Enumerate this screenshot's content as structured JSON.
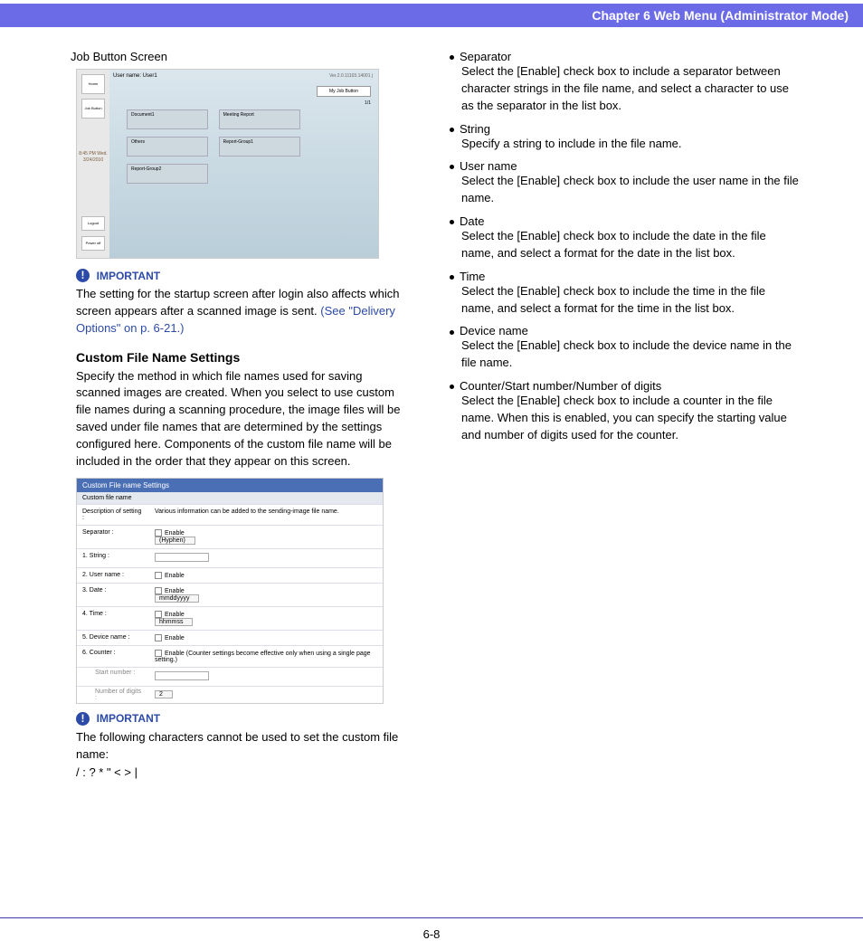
{
  "header": {
    "title": "Chapter 6   Web Menu (Administrator Mode)"
  },
  "left": {
    "caption1": "Job Button Screen",
    "ss1": {
      "user": "User name:  User1",
      "ver": "Ver.2.0.11103.14001 j",
      "btn": "My Job Button",
      "page": "1/1",
      "home": "Home",
      "jobbtn": "Job Button",
      "time": "8:45 PM Wed. 3/24/2010",
      "logout": "Logout",
      "power": "Power off",
      "tiles": [
        "Document1",
        "Meeting Report",
        "Others",
        "Report-Group1",
        "Report-Group2"
      ]
    },
    "imp1": {
      "label": "IMPORTANT",
      "text": "The setting for the startup screen after login also affects which screen appears after a scanned image is sent. ",
      "link": "(See \"Delivery Options\" on p. 6-21.)"
    },
    "h2": "Custom File Name Settings",
    "para1": "Specify the method in which file names used for saving scanned images are created. When you select to use custom file names during a scanning procedure, the image files will be saved under file names that are determined by the settings configured here. Components of the custom file name will be included in the order that they appear on this screen.",
    "ss2": {
      "title": "Custom File name  Settings",
      "sub": "Custom file name",
      "rows": [
        {
          "l": "Description of setting :",
          "v": "Various information can be added to the sending-image file name."
        },
        {
          "l": "Separator :",
          "chk": "Enable",
          "sel": "(Hyphen)"
        },
        {
          "l": "1. String :",
          "inp": true
        },
        {
          "l": "2. User name :",
          "chk": "Enable"
        },
        {
          "l": "3. Date :",
          "chk": "Enable",
          "sel": "mmddyyyy"
        },
        {
          "l": "4. Time :",
          "chk": "Enable",
          "sel": "hhmmss"
        },
        {
          "l": "5. Device name :",
          "chk": "Enable"
        },
        {
          "l": "6. Counter :",
          "chk": "Enable (Counter settings become effective only when using a single page setting.)"
        }
      ],
      "subrows": [
        {
          "l": "Start number :",
          "inp": true
        },
        {
          "l": "Number of digits :",
          "sel": "2"
        }
      ]
    },
    "imp2": {
      "label": "IMPORTANT",
      "text": "The following characters cannot be used to set the custom file name:",
      "chars": "/ : ? * \" < > |"
    }
  },
  "right": {
    "items": [
      {
        "t": "Separator",
        "d": "Select the [Enable] check box to include a separator between character strings in the file name, and select a character to use as the separator in the list box."
      },
      {
        "t": "String",
        "d": "Specify a string to include in the file name."
      },
      {
        "t": "User name",
        "d": "Select the [Enable] check box to include the user name in the file name."
      },
      {
        "t": "Date",
        "d": "Select the [Enable] check box to include the date in the file name, and select a format for the date in the list box."
      },
      {
        "t": "Time",
        "d": "Select the [Enable] check box to include the time in the file name, and select a format for the time in the list box."
      },
      {
        "t": "Device name",
        "d": "Select the [Enable] check box to include the device name in the file name."
      },
      {
        "t": "Counter/Start number/Number of digits",
        "d": "Select the [Enable] check box to include a counter in the file name. When this is enabled, you can specify the starting value and number of digits used for the counter."
      }
    ]
  },
  "footer": {
    "page": "6-8"
  }
}
